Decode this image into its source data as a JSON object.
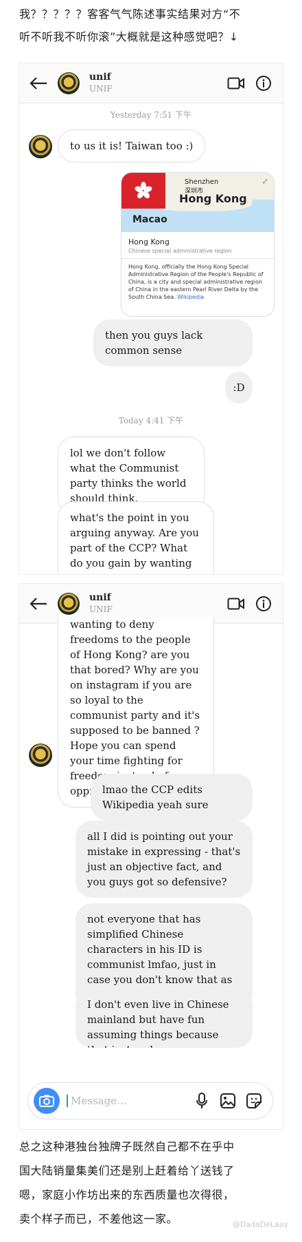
{
  "post": {
    "intro_line1": "我？？？？？客客气气陈述事实结果对方“不",
    "intro_line2": "听不听我不听你滚”大概就是这种感觉吧？↓",
    "outro_line1": "总之这种港独台独牌子既然自己都不在乎中",
    "outro_line2": "国大陆销量集美们还是别上赶着给丫送钱了",
    "outro_line3": "嗯，家庭小作坊出来的东西质量也次得很，",
    "outro_line4": "卖个样子而已，不差他这一家。",
    "watermark": "@DadaDeLaay"
  },
  "chat": {
    "username": "unif",
    "handle": "UNIF",
    "timestamp_1": "Yesterday 7:51 下午",
    "timestamp_2": "Today 4:41 下午",
    "composer_placeholder": "Message…"
  },
  "messages": {
    "m1": "to us it is! Taiwan too :)",
    "m2": "then you guys lack common sense",
    "m3": ":D",
    "m4": "lol we don't follow what the Communist party thinks the world should think.",
    "m5a": "what's the point in you arguing anyway. Are you part of the CCP? What do you gain by wanting to deny freedoms to",
    "m5b": "wanting to deny freedoms to the people of Hong Kong? are you that bored? Why are you on instagram if you are so loyal to the communist party and it's supposed to be banned ? Hope you can spend your time fighting for freedom instead of oppression",
    "m6": "lmao the CCP edits Wikipedia yeah sure",
    "m7": "all I did is pointing out your mistake in expressing - that's just an objective fact, and you guys got so defensive?",
    "m8": "not everyone that has simplified Chinese characters in his ID is communist lmfao, just in case you don't know that as a fact either",
    "m9": "I don't even live in Chinese mainland but have fun assuming things because that just makes you more and more ignorant"
  },
  "wiki_card": {
    "map_label_main": "Hong Kong",
    "map_label_city": "Shenzhen",
    "map_label_city_zh": "深圳市",
    "map_label_macao": "Macao",
    "title": "Hong Kong",
    "subtitle": "Chinese special administrative region",
    "body": "Hong Kong, officially the Hong Kong Special Administrative Region of the People's Republic of China, is a city and special administrative region of China in the eastern Pearl River Delta by the South China Sea.",
    "link": "Wikipedia"
  },
  "icons": {
    "back": "arrow-left-icon",
    "video": "video-camera-icon",
    "info": "info-icon",
    "camera": "camera-icon",
    "mic": "microphone-icon",
    "gallery": "image-icon",
    "sticker": "sticker-icon"
  },
  "colors": {
    "camera_button": "#3f8ef7",
    "incoming_bubble": "#ffffff",
    "outgoing_bubble": "#efefef",
    "flag": "#d8232a"
  }
}
